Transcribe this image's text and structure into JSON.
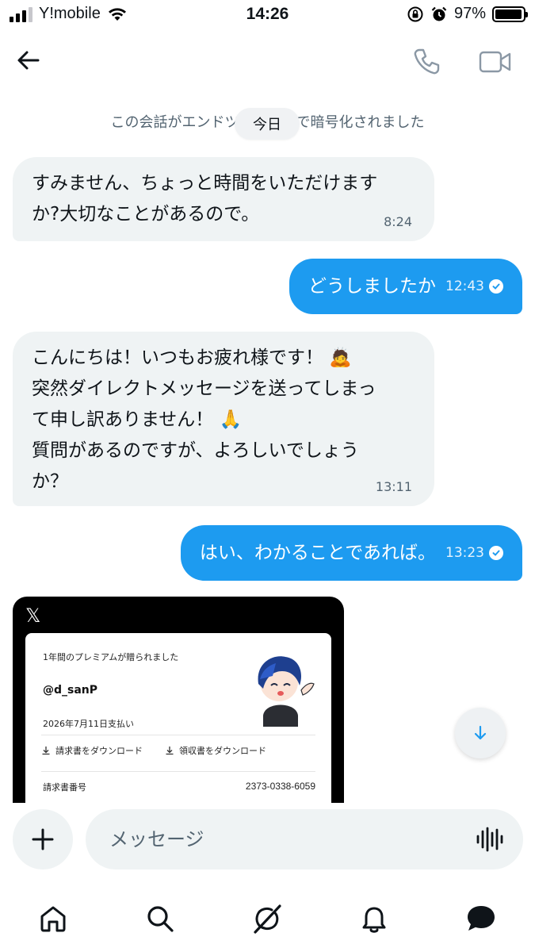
{
  "status_bar": {
    "carrier": "Y!mobile",
    "time": "14:26",
    "battery_percent": "97%",
    "battery_level": 0.97
  },
  "header": {
    "back_icon": "arrow-left-icon",
    "call_icon": "phone-icon",
    "video_icon": "video-camera-icon"
  },
  "chat": {
    "encryption_notice": "この会話がエンドツーエンドで暗号化されました",
    "date_label": "今日",
    "messages": [
      {
        "direction": "incoming",
        "lines": [
          "すみません、ちょっと時間をいただけます",
          "か?大切なことがあるので。"
        ],
        "time": "8:24"
      },
      {
        "direction": "outgoing",
        "text": "どうしましたか",
        "time": "12:43",
        "read": true
      },
      {
        "direction": "incoming",
        "lines": [
          "こんにちは！いつもお疲れ様です！ 🙇",
          "突然ダイレクトメッセージを送ってしまっ",
          "て申し訳ありません！ 🙏",
          "質問があるのですが、よろしいでしょう",
          "か？"
        ],
        "time": "13:11"
      },
      {
        "direction": "outgoing",
        "text": "はい、わかることであれば。",
        "time": "13:23",
        "read": true
      }
    ],
    "shared_image": {
      "logo": "𝕏",
      "title": "1年間のプレミアムが贈られました",
      "username": "@d_sanP",
      "payment_date": "2026年7月11日支払い",
      "invoice_download": "請求書をダウンロード",
      "receipt_download": "領収書をダウンロード",
      "invoice_number_label": "請求書番号",
      "invoice_number": "2373-0338-6059"
    }
  },
  "composer": {
    "placeholder": "メッセージ",
    "plus_icon": "plus-icon",
    "voice_icon": "voice-waveform-icon"
  },
  "bottom_nav": {
    "items": [
      "home-icon",
      "search-icon",
      "grok-icon",
      "notifications-icon",
      "messages-icon"
    ]
  },
  "colors": {
    "accent": "#1d9bf0",
    "incoming_bubble": "#eff3f4",
    "text_secondary": "#536471"
  }
}
